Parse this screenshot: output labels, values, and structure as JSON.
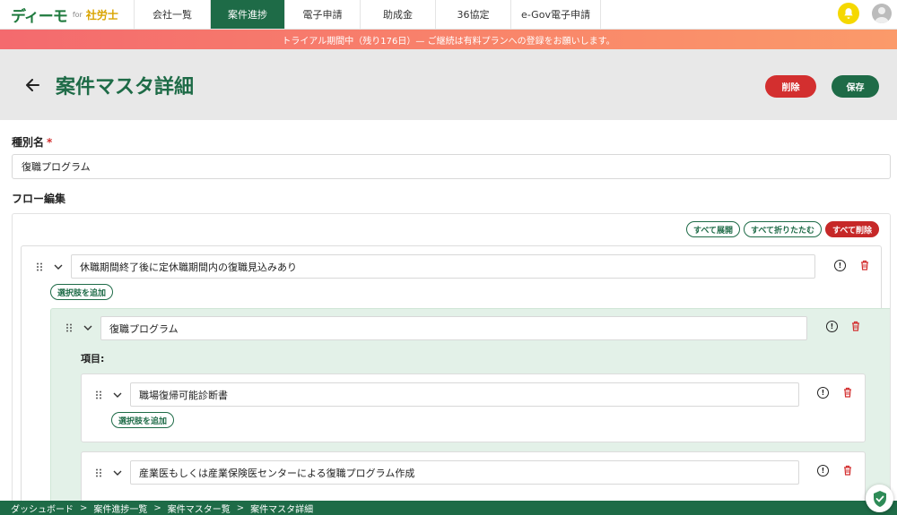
{
  "app": {
    "logo_main": "ディーモ",
    "logo_for": "for",
    "logo_sub": "社労士"
  },
  "nav": {
    "tabs": [
      {
        "label": "会社一覧",
        "active": false
      },
      {
        "label": "案件進捗",
        "active": true
      },
      {
        "label": "電子申請",
        "active": false
      },
      {
        "label": "助成金",
        "active": false
      },
      {
        "label": "36協定",
        "active": false
      },
      {
        "label": "e-Gov電子申請",
        "active": false
      }
    ],
    "icons": {
      "bell": "bell-icon",
      "avatar": "user-avatar-icon"
    }
  },
  "banner": {
    "text": "トライアル期間中（残り176日）— ご継続は有料プランへの登録をお願いします。"
  },
  "header": {
    "title": "案件マスタ詳細",
    "delete_label": "削除",
    "save_label": "保存"
  },
  "form": {
    "type_name_label": "種別名",
    "required_mark": "*",
    "type_name_value": "復職プログラム",
    "flow_label": "フロー編集"
  },
  "flow": {
    "expand_all": "すべて展開",
    "collapse_all": "すべて折りたたむ",
    "delete_all": "すべて削除",
    "add_choice_label": "選択肢を追加",
    "items_label": "項目:",
    "root_question": "休職期間終了後に定休職期間内の復職見込みあり",
    "program_name": "復職プログラム",
    "item1": "職場復帰可能診断書",
    "item2": "産業医もしくは産業保険医センターによる復職プログラム作成"
  },
  "footer": {
    "crumbs": [
      "ダッシュボード",
      "案件進捗一覧",
      "案件マスター覧",
      "案件マスタ詳細"
    ],
    "sep": ">"
  },
  "colors": {
    "brand_green": "#1e6b47",
    "danger_red": "#d32f2f",
    "banner_gradient_start": "#f46a6e",
    "banner_gradient_end": "#fb9a6a",
    "node_green_bg": "#e3f1e8"
  }
}
